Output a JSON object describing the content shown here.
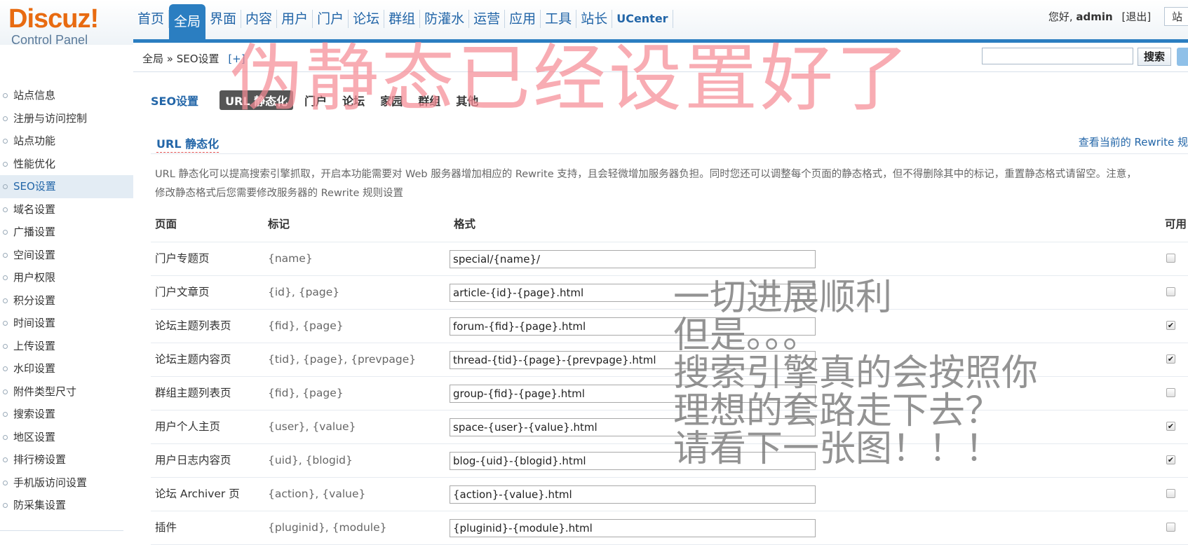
{
  "logo": {
    "brand": "Discuz!",
    "subtitle": "Control Panel"
  },
  "nav": {
    "items": [
      "首页",
      "全局",
      "界面",
      "内容",
      "用户",
      "门户",
      "论坛",
      "群组",
      "防灌水",
      "运营",
      "应用",
      "工具",
      "站长",
      "UCenter"
    ],
    "active_index": 1
  },
  "user": {
    "greeting": "您好,",
    "name": "admin",
    "logout": "[退出]",
    "site_link": "站"
  },
  "breadcrumb": {
    "path": "全局 » SEO设置",
    "toggle": "[+]"
  },
  "search": {
    "value": "",
    "button": "搜索"
  },
  "sidebar": {
    "items": [
      "站点信息",
      "注册与访问控制",
      "站点功能",
      "性能优化",
      "SEO设置",
      "域名设置",
      "广播设置",
      "空间设置",
      "用户权限",
      "积分设置",
      "时间设置",
      "上传设置",
      "水印设置",
      "附件类型尺寸",
      "搜索设置",
      "地区设置",
      "排行榜设置",
      "手机版访问设置",
      "防采集设置"
    ],
    "active_index": 4
  },
  "tabs": {
    "title": "SEO设置",
    "items": [
      "URL 静态化",
      "门户",
      "论坛",
      "家园",
      "群组",
      "其他"
    ],
    "active_index": 0
  },
  "section": {
    "title": "URL 静态化",
    "rewrite_link": "查看当前的 Rewrite 规",
    "description": "URL 静态化可以提高搜索引擎抓取，开启本功能需要对 Web 服务器增加相应的 Rewrite 支持，且会轻微增加服务器负担。同时您还可以调整每个页面的静态格式，但不得删除其中的标记，重置静态格式请留空。注意，修改静态格式后您需要修改服务器的 Rewrite 规则设置"
  },
  "table": {
    "headers": {
      "page": "页面",
      "mark": "标记",
      "format": "格式",
      "enabled": "可用"
    },
    "rows": [
      {
        "page": "门户专题页",
        "mark": "{name}",
        "format": "special/{name}/",
        "enabled": false
      },
      {
        "page": "门户文章页",
        "mark": "{id}, {page}",
        "format": "article-{id}-{page}.html",
        "enabled": false
      },
      {
        "page": "论坛主题列表页",
        "mark": "{fid}, {page}",
        "format": "forum-{fid}-{page}.html",
        "enabled": true
      },
      {
        "page": "论坛主题内容页",
        "mark": "{tid}, {page}, {prevpage}",
        "format": "thread-{tid}-{page}-{prevpage}.html",
        "enabled": true
      },
      {
        "page": "群组主题列表页",
        "mark": "{fid}, {page}",
        "format": "group-{fid}-{page}.html",
        "enabled": false
      },
      {
        "page": "用户个人主页",
        "mark": "{user}, {value}",
        "format": "space-{user}-{value}.html",
        "enabled": true
      },
      {
        "page": "用户日志内容页",
        "mark": "{uid}, {blogid}",
        "format": "blog-{uid}-{blogid}.html",
        "enabled": true
      },
      {
        "page": "论坛 Archiver 页",
        "mark": "{action}, {value}",
        "format": "{action}-{value}.html",
        "enabled": false
      },
      {
        "page": "插件",
        "mark": "{pluginid}, {module}",
        "format": "{pluginid}-{module}.html",
        "enabled": false
      }
    ]
  },
  "overlay": {
    "watermark": "伪静态已经设置好了",
    "comment_lines": [
      "一切进展顺利",
      "但是。。。",
      "搜索引擎真的会按照你",
      "理想的套路走下去？",
      "请看下一张图！！！"
    ]
  },
  "colors": {
    "accent": "#2b7ec1",
    "link": "#2366a8",
    "logo": "#e86b11",
    "watermark": "#f58c96"
  }
}
